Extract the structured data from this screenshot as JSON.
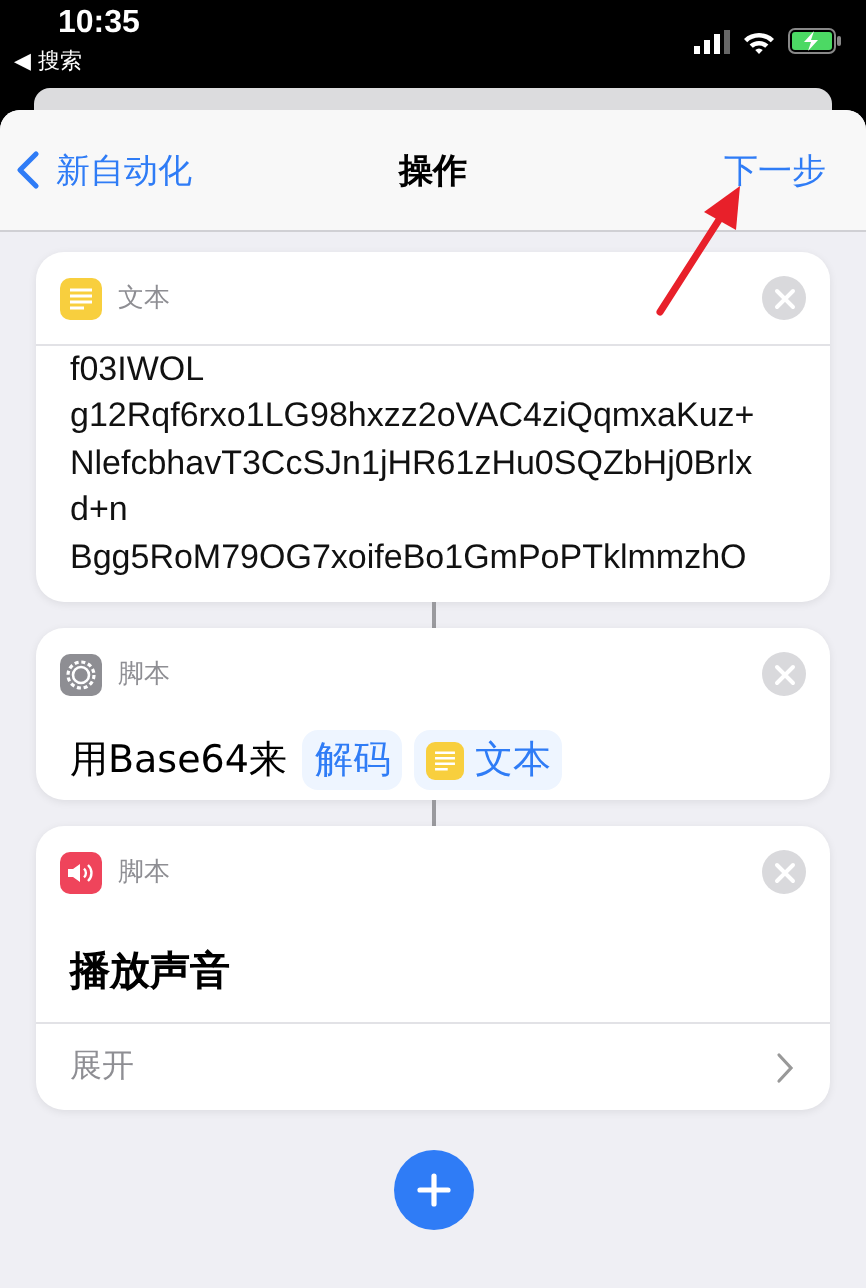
{
  "status_bar": {
    "time": "10:35",
    "back_app": "◀ 搜索"
  },
  "nav": {
    "back": "新自动化",
    "title": "操作",
    "next": "下一步"
  },
  "actions": [
    {
      "kind": "text",
      "category": "文本",
      "lines": [
        "f03IWOL",
        "g12Rqf6rxo1LG98hxzz2oVAC4ziQqmxaKuz+",
        "NlefcbhavT3CcSJn1jHR61zHu0SQZbHj0Brlx",
        "d+n",
        "Bgg5RoM79OG7xoifeBo1GmPoPTklmmzhO"
      ]
    },
    {
      "kind": "decode",
      "category": "脚本",
      "prefix": "用Base64来",
      "mode": "解码",
      "input": "文本"
    },
    {
      "kind": "sound",
      "category": "脚本",
      "title": "播放声音",
      "expand": "展开"
    }
  ]
}
